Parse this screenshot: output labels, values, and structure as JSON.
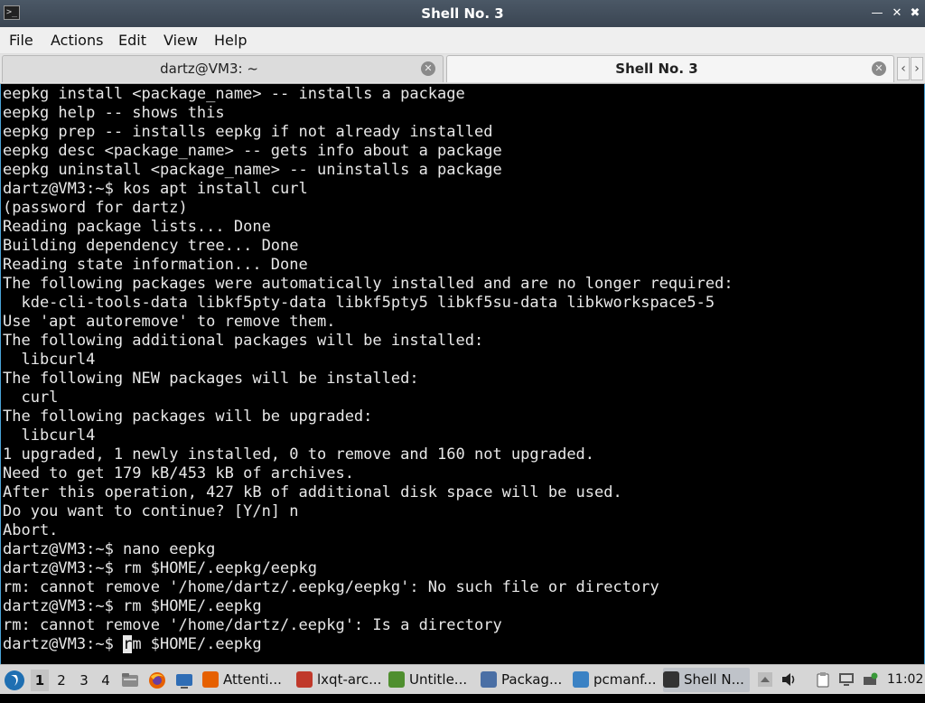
{
  "window": {
    "title": "Shell No. 3"
  },
  "menu": [
    "File",
    "Actions",
    "Edit",
    "View",
    "Help"
  ],
  "tabs": [
    {
      "label": "dartz@VM3: ~",
      "active": false
    },
    {
      "label": "Shell No. 3",
      "active": true
    }
  ],
  "terminal": {
    "lines": [
      "eepkg install <package_name> -- installs a package",
      "eepkg help -- shows this",
      "eepkg prep -- installs eepkg if not already installed",
      "eepkg desc <package_name> -- gets info about a package",
      "eepkg uninstall <package_name> -- uninstalls a package",
      "dartz@VM3:~$ kos apt install curl",
      "(password for dartz)",
      "Reading package lists... Done",
      "Building dependency tree... Done",
      "Reading state information... Done",
      "The following packages were automatically installed and are no longer required:",
      "  kde-cli-tools-data libkf5pty-data libkf5pty5 libkf5su-data libkworkspace5-5",
      "Use 'apt autoremove' to remove them.",
      "The following additional packages will be installed:",
      "  libcurl4",
      "The following NEW packages will be installed:",
      "  curl",
      "The following packages will be upgraded:",
      "  libcurl4",
      "1 upgraded, 1 newly installed, 0 to remove and 160 not upgraded.",
      "Need to get 179 kB/453 kB of archives.",
      "After this operation, 427 kB of additional disk space will be used.",
      "Do you want to continue? [Y/n] n",
      "Abort.",
      "dartz@VM3:~$ nano eepkg",
      "dartz@VM3:~$ rm $HOME/.eepkg/eepkg",
      "rm: cannot remove '/home/dartz/.eepkg/eepkg': No such file or directory",
      "dartz@VM3:~$ rm $HOME/.eepkg",
      "rm: cannot remove '/home/dartz/.eepkg': Is a directory"
    ],
    "prompt": {
      "before_cursor": "dartz@VM3:~$ ",
      "cursor_char": "r",
      "after_cursor": "m $HOME/.eepkg"
    }
  },
  "taskbar": {
    "desktops": [
      "1",
      "2",
      "3",
      "4"
    ],
    "active_desktop": "1",
    "tasks": [
      {
        "label": "Attenti...",
        "icon": "firefox-icon",
        "color": "#e66000"
      },
      {
        "label": "lxqt-arc...",
        "icon": "archiver-icon",
        "color": "#c0392b"
      },
      {
        "label": "Untitle...",
        "icon": "text-editor-icon",
        "color": "#4f8f2f"
      },
      {
        "label": "Packag...",
        "icon": "package-manager-icon",
        "color": "#4a6fa5"
      },
      {
        "label": "pcmanf...",
        "icon": "folder-icon",
        "color": "#3b82c4"
      },
      {
        "label": "Shell N...",
        "icon": "terminal-icon",
        "color": "#333333",
        "active": true
      }
    ],
    "clock": "11:02"
  },
  "colors": {
    "titlebar": "#3f4a57",
    "terminal_bg": "#000000",
    "terminal_fg": "#e8e8e8",
    "accent": "#4aa3d8",
    "taskbar": "#d6d6d6"
  }
}
